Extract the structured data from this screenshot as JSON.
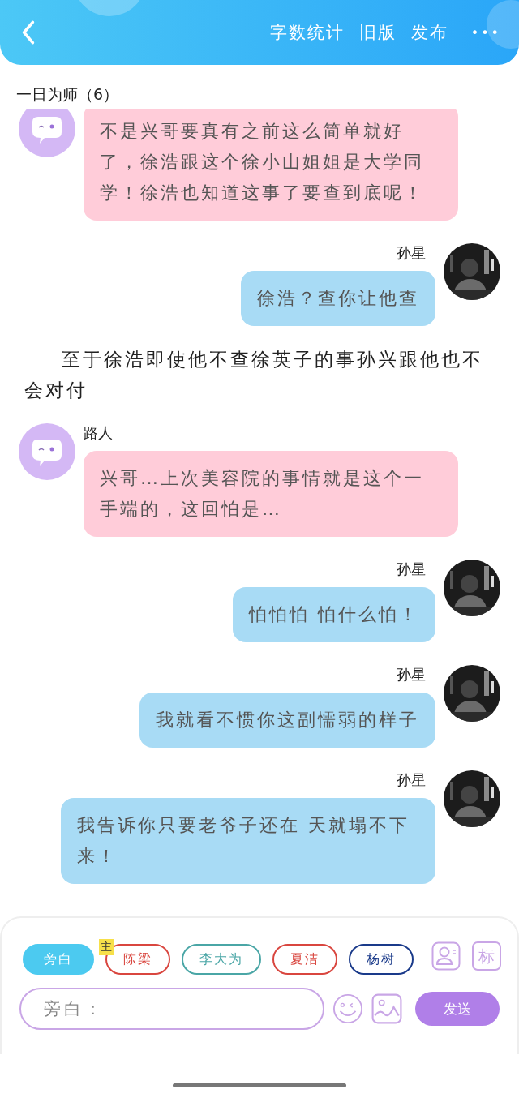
{
  "header": {
    "actions": [
      "字数统计",
      "旧版",
      "发布"
    ],
    "more": "•••"
  },
  "title": "一日为师（6）",
  "messages": [
    {
      "kind": "left",
      "text": "不是兴哥要真有之前这么简单就好了，徐浩跟这个徐小山姐姐是大学同学！徐浩也知道这事了要查到底呢！"
    },
    {
      "kind": "right",
      "name": "孙星",
      "text": "徐浩？查你让他查"
    },
    {
      "kind": "narration",
      "text": "至于徐浩即使他不查徐英子的事孙兴跟他也不会对付"
    },
    {
      "kind": "left",
      "name": "路人",
      "text": "兴哥…上次美容院的事情就是这个一手端的，这回怕是…"
    },
    {
      "kind": "right",
      "name": "孙星",
      "text": "怕怕怕 怕什么怕！"
    },
    {
      "kind": "right",
      "name": "孙星",
      "text": "我就看不惯你这副懦弱的样子"
    },
    {
      "kind": "right",
      "name": "孙星",
      "text": "我告诉你只要老爷子还在 天就塌不下来！"
    }
  ],
  "roles": [
    {
      "label": "旁白",
      "selected": true
    },
    {
      "label": "陈梁",
      "selected": false,
      "color": "#d9463f",
      "badge": "主"
    },
    {
      "label": "李大为",
      "selected": false,
      "color": "#4aa6a6"
    },
    {
      "label": "夏洁",
      "selected": false,
      "color": "#d9463f"
    },
    {
      "label": "杨树",
      "selected": false,
      "color": "#1a3a8a"
    }
  ],
  "role_tools": [
    "标"
  ],
  "input": {
    "placeholder": "旁白："
  },
  "send": "发送"
}
